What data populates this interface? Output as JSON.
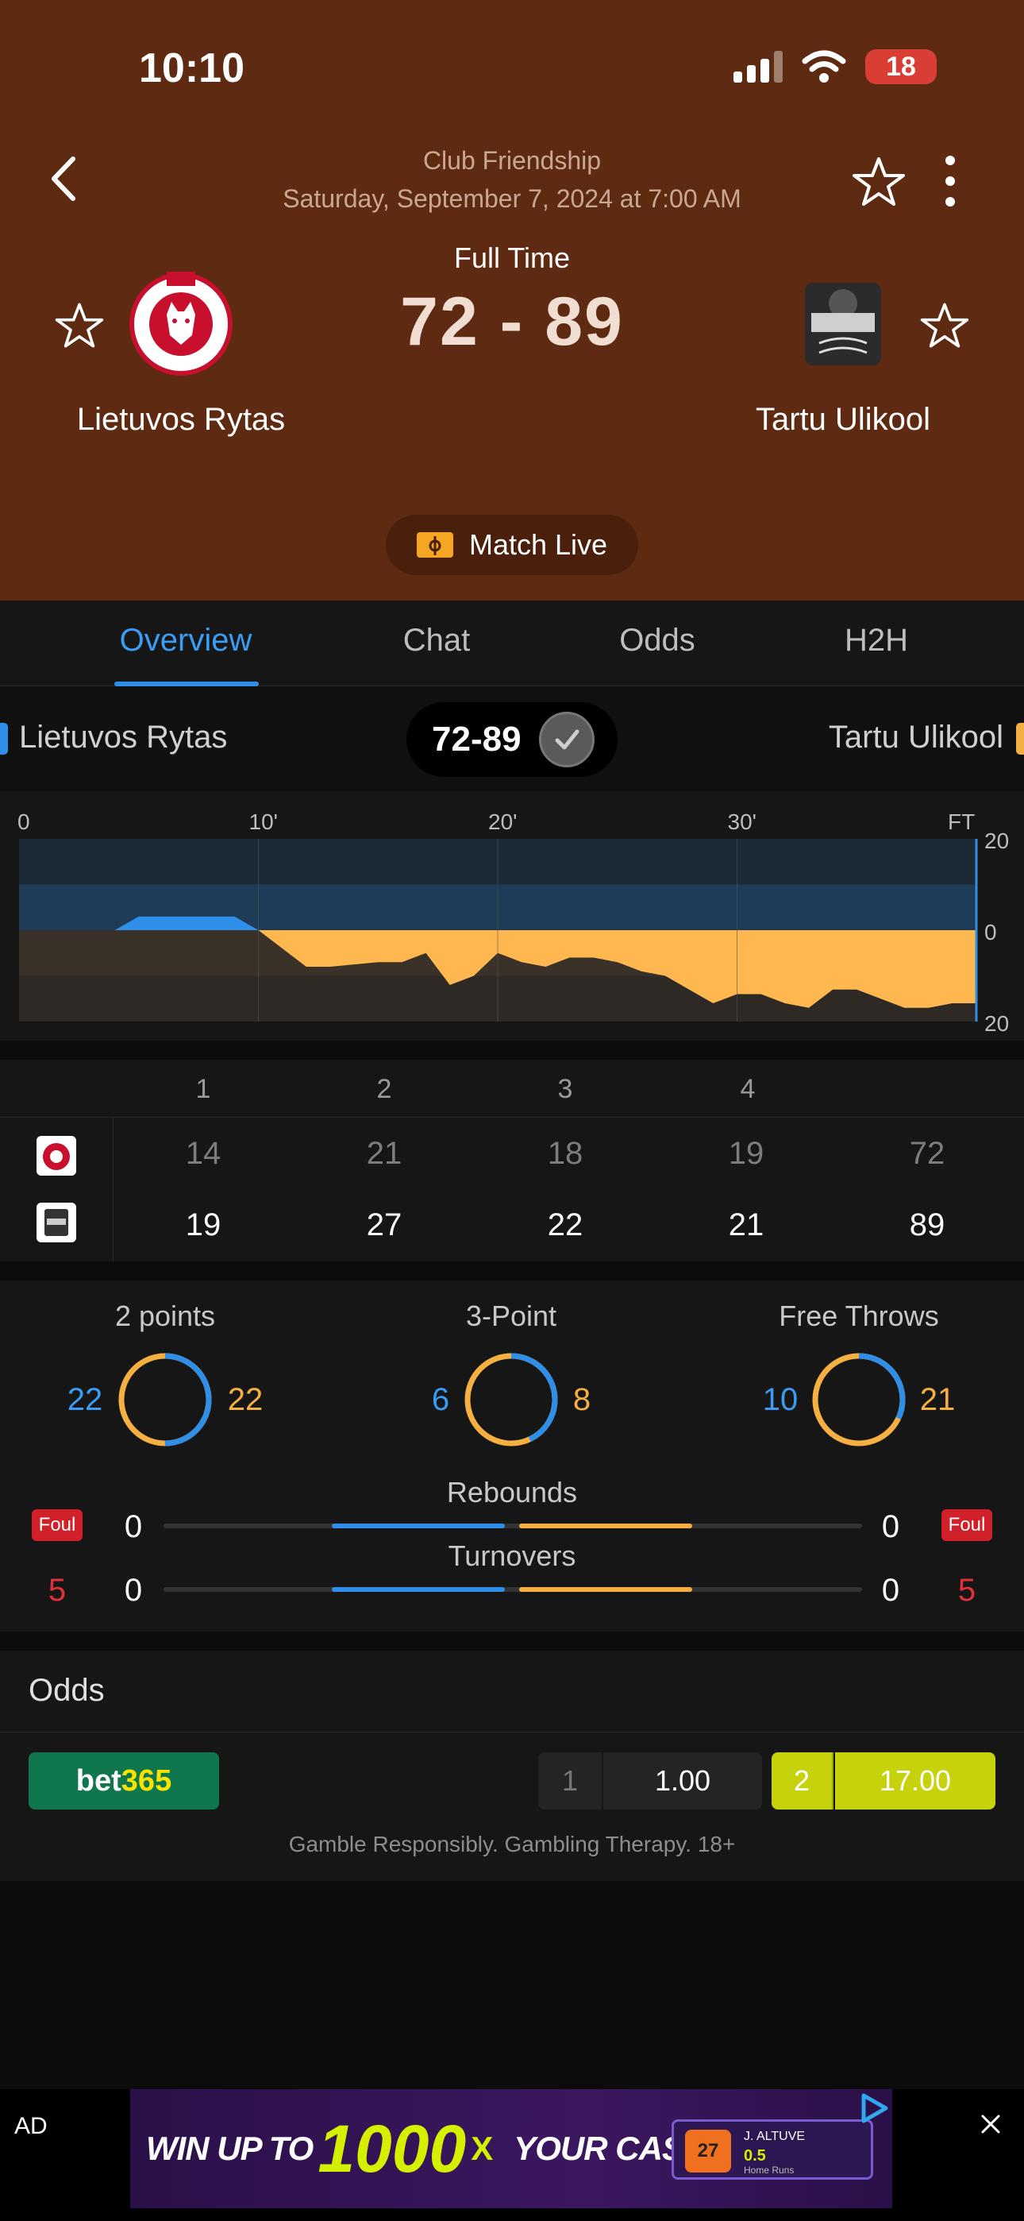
{
  "status_bar": {
    "time": "10:10",
    "battery": "18"
  },
  "header": {
    "competition": "Club Friendship",
    "date": "Saturday, September 7, 2024 at 7:00 AM",
    "status": "Full Time",
    "score": "72 - 89",
    "home_team": "Lietuvos Rytas",
    "away_team": "Tartu Ulikool",
    "match_live": "Match Live"
  },
  "tabs": [
    "Overview",
    "Chat",
    "Odds",
    "H2H"
  ],
  "scorebar": {
    "home": "Lietuvos Rytas",
    "away": "Tartu Ulikool",
    "score": "72-89"
  },
  "chart_data": {
    "type": "area",
    "x_ticks": [
      "0",
      "10'",
      "20'",
      "30'",
      "FT"
    ],
    "y_ticks": [
      "20",
      "0",
      "20"
    ],
    "ylim": [
      -20,
      20
    ],
    "series": [
      {
        "x": [
          0,
          4,
          5,
          9,
          10,
          11,
          12,
          13,
          15,
          16,
          17,
          18,
          19,
          20,
          21,
          22,
          23,
          24,
          25,
          26,
          27,
          28,
          29,
          30,
          31,
          32,
          33,
          34,
          35,
          36,
          37,
          38,
          39,
          40
        ],
        "values": [
          0,
          0,
          3,
          3,
          0,
          -4,
          -8,
          -8,
          -7,
          -7,
          -5,
          -12,
          -10,
          -5,
          -7,
          -8,
          -6,
          -6,
          -7,
          -9,
          -10,
          -13,
          -16,
          -14,
          -14,
          -16,
          -17,
          -13,
          -13,
          -15,
          -17,
          -17,
          -16,
          -16
        ]
      }
    ],
    "colors": {
      "home": "#2f8fe8",
      "away": "#ffb850"
    }
  },
  "quarters": {
    "headers": [
      "1",
      "2",
      "3",
      "4"
    ],
    "home": [
      "14",
      "21",
      "18",
      "19",
      "72"
    ],
    "away": [
      "19",
      "27",
      "22",
      "21",
      "89"
    ]
  },
  "stats": {
    "two_points": {
      "label": "2 points",
      "home": "22",
      "away": "22",
      "home_frac": 0.5
    },
    "three_points": {
      "label": "3-Point",
      "home": "6",
      "away": "8",
      "home_frac": 0.43
    },
    "free_throws": {
      "label": "Free Throws",
      "home": "10",
      "away": "21",
      "home_frac": 0.32
    },
    "rebounds": {
      "label": "Rebounds",
      "home": "0",
      "away": "0"
    },
    "turnovers": {
      "label": "Turnovers",
      "home": "0",
      "away": "0"
    },
    "foul_label": "Foul",
    "home_fouls": "5",
    "away_fouls": "5"
  },
  "odds": {
    "title": "Odds",
    "bookmaker": {
      "part1": "bet",
      "part2": "365"
    },
    "home_label": "1",
    "home_value": "1.00",
    "away_label": "2",
    "away_value": "17.00",
    "disclaimer": "Gamble Responsibly. Gambling Therapy. 18+"
  },
  "ad": {
    "label": "AD",
    "text1": "WIN UP TO",
    "big": "1000",
    "x": "X",
    "text2": "YOUR CASH",
    "card_name": "J. ALTUVE",
    "card_value": "0.5",
    "card_sub": "Home Runs",
    "jersey": "27"
  },
  "colors": {
    "header_bg": "#5e2a12",
    "accent_blue": "#2f8fe8",
    "accent_orange": "#f5b041",
    "foul_red": "#d0202a"
  }
}
